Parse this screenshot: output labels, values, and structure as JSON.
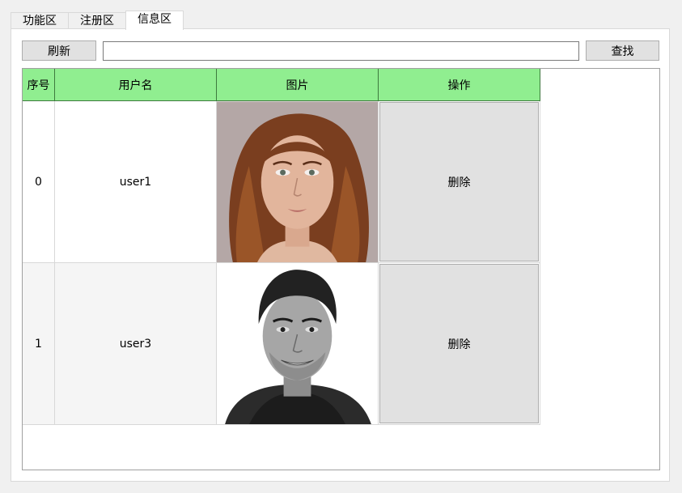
{
  "tabs": [
    {
      "label": "功能区",
      "active": false
    },
    {
      "label": "注册区",
      "active": false
    },
    {
      "label": "信息区",
      "active": true
    }
  ],
  "toolbar": {
    "refresh_label": "刷新",
    "search_value": "",
    "search_label": "查找"
  },
  "table": {
    "columns": [
      "序号",
      "用户名",
      "图片",
      "操作"
    ],
    "header_color": "#90ee90",
    "rows": [
      {
        "index": "0",
        "username": "user1",
        "photo": "portrait-woman",
        "action": "删除"
      },
      {
        "index": "1",
        "username": "user3",
        "photo": "portrait-man-bw",
        "action": "删除"
      }
    ]
  }
}
